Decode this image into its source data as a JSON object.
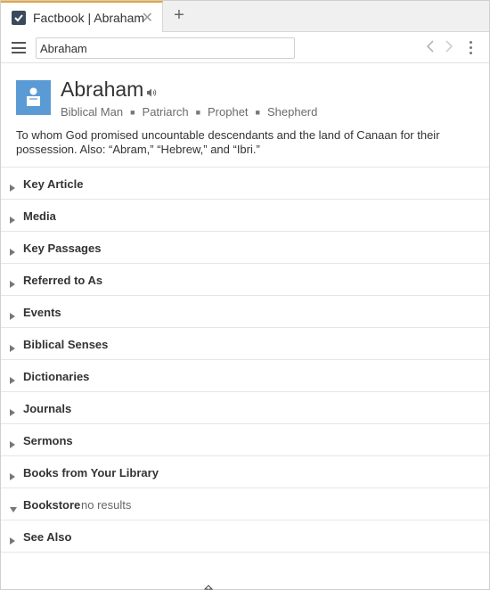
{
  "tab": {
    "title": "Factbook | Abraham",
    "close_icon": "close-icon",
    "new_tab_icon": "plus-icon"
  },
  "toolbar": {
    "search_value": "Abraham",
    "menu_icon": "hamburger-menu-icon",
    "back_icon": "chevron-left-icon",
    "forward_icon": "chevron-right-icon",
    "more_icon": "kebab-menu-icon"
  },
  "entity": {
    "title": "Abraham",
    "categories": [
      "Biblical Man",
      "Patriarch",
      "Prophet",
      "Shepherd"
    ],
    "description": "To whom God promised uncountable descendants and the land of Canaan for their possession. Also: “Abram,” “Hebrew,” and “Ibri.”",
    "icon_color": "#5b9bd5"
  },
  "sections": [
    {
      "label": "Key Article",
      "expanded": false,
      "extra": ""
    },
    {
      "label": "Media",
      "expanded": false,
      "extra": ""
    },
    {
      "label": "Key Passages",
      "expanded": false,
      "extra": ""
    },
    {
      "label": "Referred to As",
      "expanded": false,
      "extra": ""
    },
    {
      "label": "Events",
      "expanded": false,
      "extra": ""
    },
    {
      "label": "Biblical Senses",
      "expanded": false,
      "extra": ""
    },
    {
      "label": "Dictionaries",
      "expanded": false,
      "extra": ""
    },
    {
      "label": "Journals",
      "expanded": false,
      "extra": ""
    },
    {
      "label": "Sermons",
      "expanded": false,
      "extra": ""
    },
    {
      "label": "Books from Your Library",
      "expanded": false,
      "extra": ""
    },
    {
      "label": "Bookstore",
      "expanded": true,
      "extra": "no results"
    },
    {
      "label": "See Also",
      "expanded": false,
      "extra": ""
    }
  ],
  "colors": {
    "accent_tab": "#e8a33a",
    "entity_icon": "#5b9bd5"
  }
}
